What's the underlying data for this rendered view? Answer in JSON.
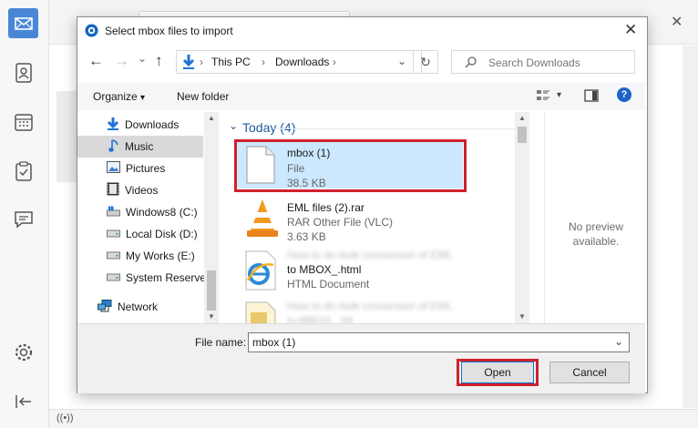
{
  "dialog": {
    "title": "Select mbox files to import",
    "close_glyph": "✕"
  },
  "navigation": {
    "back_glyph": "←",
    "forward_glyph": "→",
    "recent_glyph": "⌄",
    "up_glyph": "↑",
    "breadcrumb": [
      "This PC",
      "Downloads"
    ],
    "separator": "›",
    "dropdown_glyph": "⌄",
    "refresh_glyph": "↻",
    "search_placeholder": "Search Downloads"
  },
  "toolbar": {
    "organize_label": "Organize",
    "organize_arrow": "▾",
    "new_folder_label": "New folder",
    "view_arrow": "▾",
    "help_glyph": "?"
  },
  "tree": {
    "items": [
      {
        "label": "Downloads",
        "icon": "download-arrow-icon"
      },
      {
        "label": "Music",
        "icon": "music-note-icon",
        "selected": true
      },
      {
        "label": "Pictures",
        "icon": "pictures-icon"
      },
      {
        "label": "Videos",
        "icon": "videos-icon"
      },
      {
        "label": "Windows8 (C:)",
        "icon": "windows-drive-icon"
      },
      {
        "label": "Local Disk (D:)",
        "icon": "drive-icon"
      },
      {
        "label": "My Works (E:)",
        "icon": "drive-icon"
      },
      {
        "label": "System Reserved",
        "icon": "drive-icon"
      },
      {
        "label": "Network",
        "icon": "network-icon"
      }
    ]
  },
  "files": {
    "group_label": "Today (4)",
    "group_toggle": "⌄",
    "items": [
      {
        "name": "mbox (1)",
        "type": "File",
        "size": "38.5 KB",
        "selected": true
      },
      {
        "name": "EML files (2).rar",
        "type": "RAR Other File (VLC)",
        "size": "3.63 KB"
      },
      {
        "name_blurred": "How to do bulk conversion of EML",
        "name": "to MBOX_.html",
        "type": "HTML Document"
      },
      {
        "name_blurred": "How to do bulk conversion of EML",
        "name": "to MBOX_.Sh"
      }
    ]
  },
  "preview": {
    "text": "No preview available."
  },
  "footer": {
    "filename_label": "File name:",
    "filename_value": "mbox (1)",
    "open_label": "Open",
    "cancel_label": "Cancel"
  },
  "colors": {
    "accent": "#0078d7",
    "highlight_box": "#d0202d",
    "selection": "#cce8ff"
  }
}
